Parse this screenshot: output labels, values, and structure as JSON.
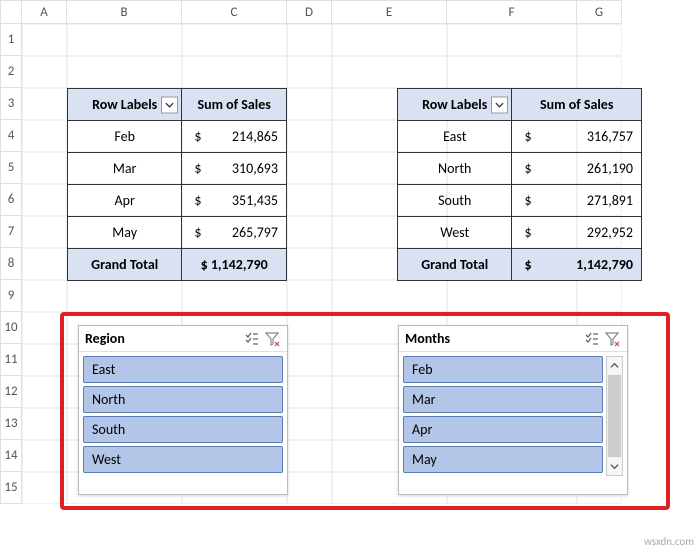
{
  "columns": [
    "A",
    "B",
    "C",
    "D",
    "E",
    "F",
    "G"
  ],
  "rows": [
    "1",
    "2",
    "3",
    "4",
    "5",
    "6",
    "7",
    "8",
    "9",
    "10",
    "11",
    "12",
    "13",
    "14",
    "15"
  ],
  "pivot1": {
    "headers": [
      "Row Labels",
      "Sum of Sales"
    ],
    "rows": [
      {
        "label": "Feb",
        "value": "214,865"
      },
      {
        "label": "Mar",
        "value": "310,693"
      },
      {
        "label": "Apr",
        "value": "351,435"
      },
      {
        "label": "May",
        "value": "265,797"
      }
    ],
    "total": {
      "label": "Grand Total",
      "value": "$ 1,142,790"
    }
  },
  "pivot2": {
    "headers": [
      "Row Labels",
      "Sum of Sales"
    ],
    "rows": [
      {
        "label": "East",
        "value": "316,757"
      },
      {
        "label": "North",
        "value": "261,190"
      },
      {
        "label": "South",
        "value": "271,891"
      },
      {
        "label": "West",
        "value": "292,952"
      }
    ],
    "total": {
      "label": "Grand Total",
      "value": "1,142,790"
    }
  },
  "slicer1": {
    "title": "Region",
    "items": [
      "East",
      "North",
      "South",
      "West"
    ]
  },
  "slicer2": {
    "title": "Months",
    "items": [
      "Feb",
      "Mar",
      "Apr",
      "May"
    ]
  },
  "currency": "$",
  "watermark": "wsxdn.com",
  "chart_data": [
    {
      "type": "table",
      "title": "Sum of Sales by Month",
      "categories": [
        "Feb",
        "Mar",
        "Apr",
        "May"
      ],
      "values": [
        214865,
        310693,
        351435,
        265797
      ],
      "total": 1142790
    },
    {
      "type": "table",
      "title": "Sum of Sales by Region",
      "categories": [
        "East",
        "North",
        "South",
        "West"
      ],
      "values": [
        316757,
        261190,
        271891,
        292952
      ],
      "total": 1142790
    }
  ]
}
